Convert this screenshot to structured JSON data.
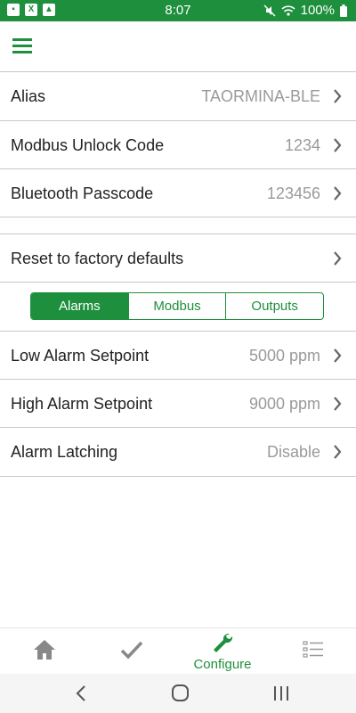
{
  "status": {
    "time": "8:07",
    "battery": "100%"
  },
  "icons": {
    "menu": "hamburger-menu-icon",
    "chevron": "chevron-right-icon"
  },
  "colors": {
    "accent": "#1e8f3c",
    "value_text": "#9a9a9a"
  },
  "settings": [
    {
      "label": "Alias",
      "value": "TAORMINA-BLE"
    },
    {
      "label": "Modbus Unlock Code",
      "value": "1234"
    },
    {
      "label": "Bluetooth Passcode",
      "value": "123456"
    }
  ],
  "reset": {
    "label": "Reset to factory defaults"
  },
  "segments": {
    "items": [
      "Alarms",
      "Modbus",
      "Outputs"
    ],
    "selected": "Alarms"
  },
  "alarms": [
    {
      "label": "Low Alarm Setpoint",
      "value": "5000 ppm"
    },
    {
      "label": "High Alarm Setpoint",
      "value": "9000 ppm"
    },
    {
      "label": "Alarm Latching",
      "value": "Disable"
    }
  ],
  "tabs": {
    "configure_label": "Configure",
    "selected": "configure"
  }
}
